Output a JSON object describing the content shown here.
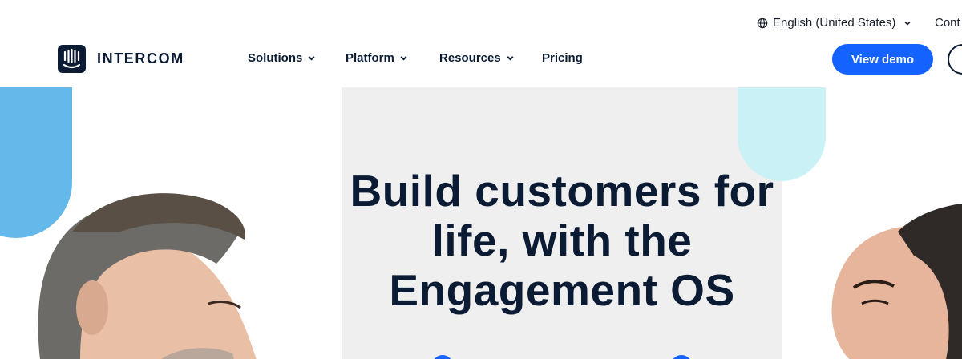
{
  "utility": {
    "language": "English (United States)",
    "contact": "Cont"
  },
  "brand": {
    "name": "INTERCOM"
  },
  "nav": {
    "items": [
      {
        "label": "Solutions",
        "has_dropdown": true
      },
      {
        "label": "Platform",
        "has_dropdown": true
      },
      {
        "label": "Resources",
        "has_dropdown": true
      },
      {
        "label": "Pricing",
        "has_dropdown": false
      }
    ],
    "cta_primary": "View demo"
  },
  "hero": {
    "headline_line1": "Build customers for",
    "headline_line2": "life, with the",
    "headline_line3": "Engagement OS"
  },
  "colors": {
    "navy": "#0b1b33",
    "primary_blue": "#1462ff",
    "shape_blue": "#64b9ea",
    "shape_cyan": "#c9f1f6",
    "panel_gray": "#efefef"
  },
  "icons": [
    "globe-icon",
    "chevron-down-icon",
    "intercom-logo-icon"
  ]
}
